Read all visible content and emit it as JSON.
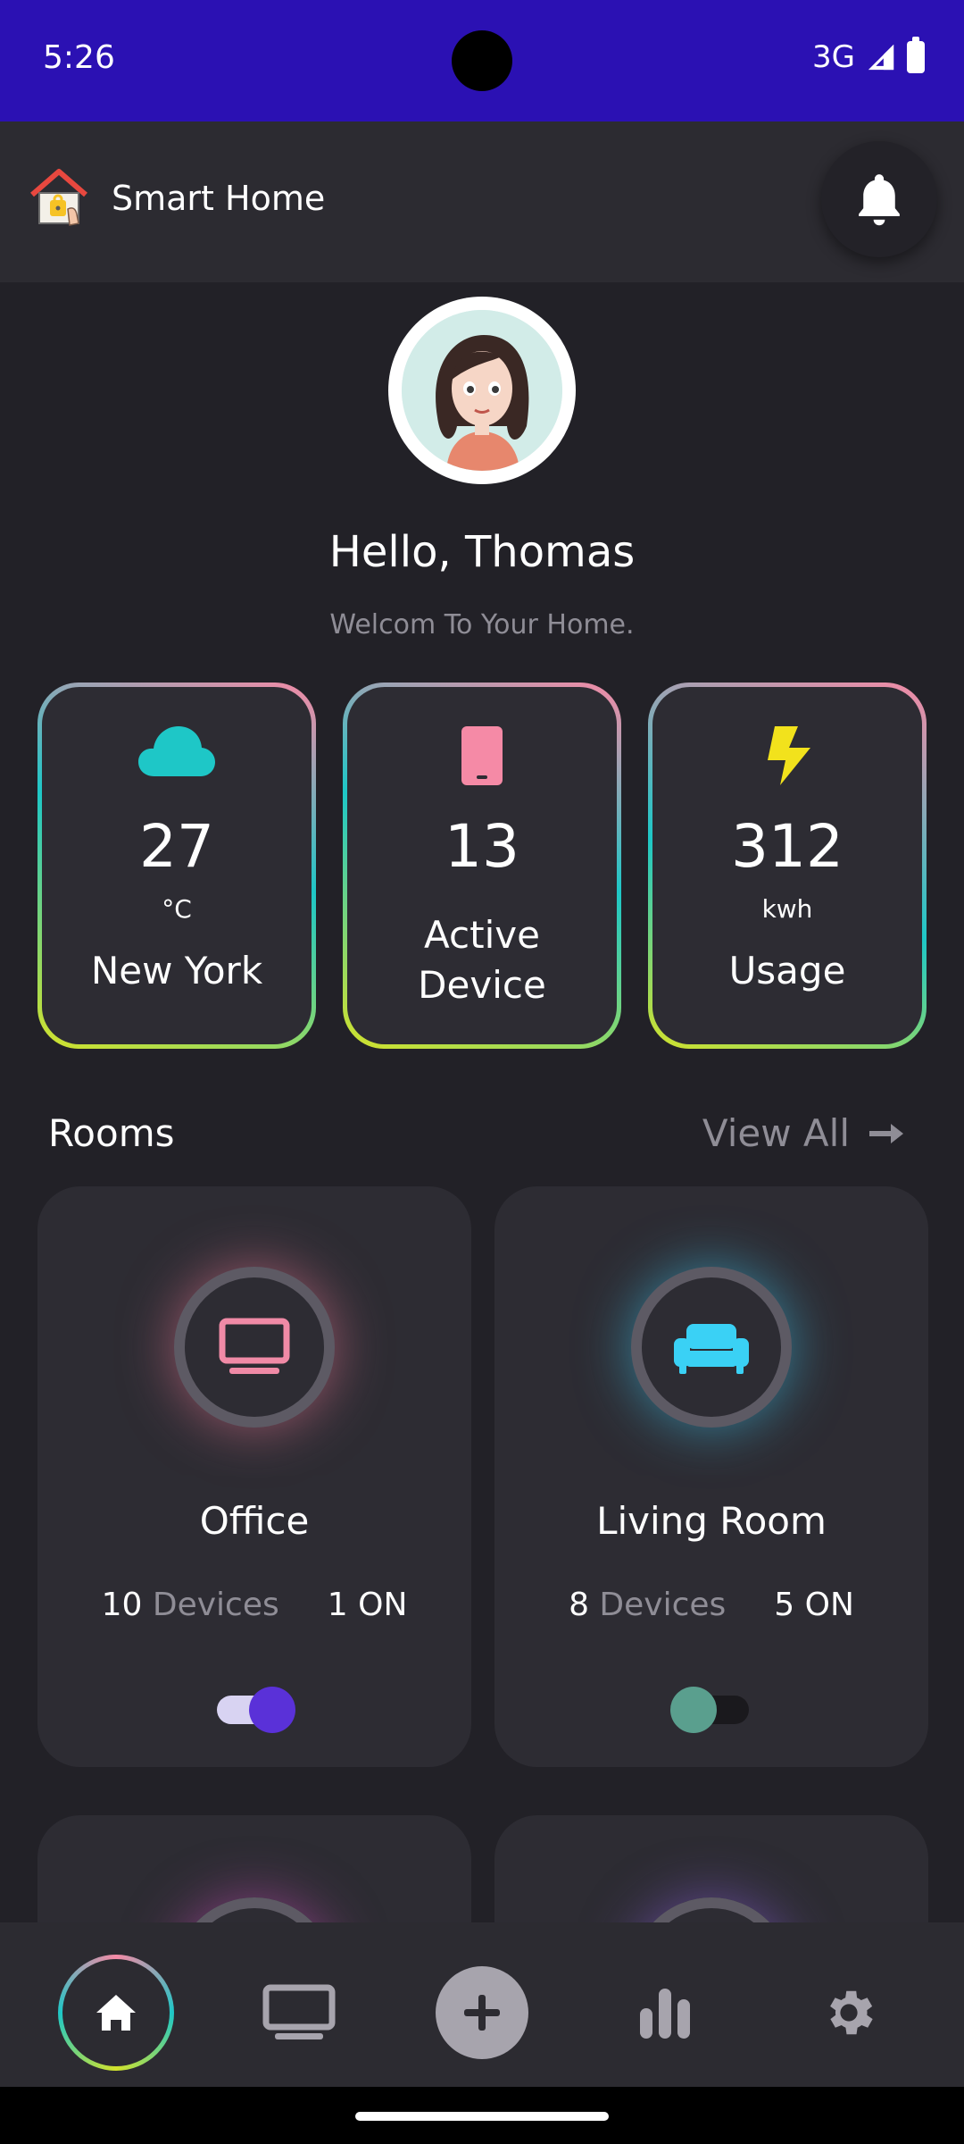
{
  "status_bar": {
    "time": "5:26",
    "network": "3G"
  },
  "app_bar": {
    "title": "Smart Home"
  },
  "profile": {
    "greeting": "Hello, Thomas",
    "welcome": "Welcom To Your Home."
  },
  "stats": [
    {
      "icon": "cloud-icon",
      "value": "27",
      "unit": "°C",
      "label": "New York",
      "color": "#1ec7c7"
    },
    {
      "icon": "phone-icon",
      "value": "13",
      "label": "Active Device",
      "color": "#f58aa6"
    },
    {
      "icon": "lightning-icon",
      "value": "312",
      "unit": "kwh",
      "label": "Usage",
      "color": "#f2e21c"
    }
  ],
  "rooms_section": {
    "title": "Rooms",
    "view_all": "View All"
  },
  "rooms": [
    {
      "name": "Office",
      "devices_count": "10",
      "devices_word": "Devices",
      "on_count": "1",
      "on_word": "ON",
      "icon": "monitor-icon",
      "accent": "#f08aa6",
      "switch_on": true
    },
    {
      "name": "Living Room",
      "devices_count": "8",
      "devices_word": "Devices",
      "on_count": "5",
      "on_word": "ON",
      "icon": "sofa-icon",
      "accent": "#3ad1f5",
      "switch_on": false
    }
  ],
  "bottom_nav": [
    {
      "name": "home",
      "icon": "home-icon",
      "active": true
    },
    {
      "name": "devices",
      "icon": "monitor-icon"
    },
    {
      "name": "add",
      "icon": "plus-icon"
    },
    {
      "name": "statistics",
      "icon": "bar-chart-icon"
    },
    {
      "name": "settings",
      "icon": "gear-icon"
    }
  ]
}
